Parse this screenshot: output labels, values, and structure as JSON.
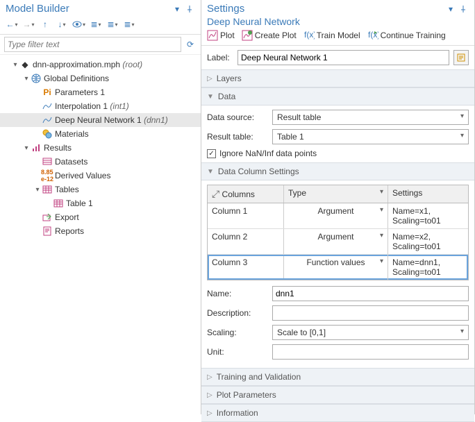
{
  "left_panel": {
    "title": "Model Builder",
    "filter_placeholder": "Type filter text",
    "tree": {
      "root": {
        "label": "dnn-approximation.mph",
        "suffix": "(root)"
      },
      "global_def": {
        "label": "Global Definitions"
      },
      "parameters": {
        "label": "Parameters 1"
      },
      "interpolation": {
        "label": "Interpolation 1",
        "suffix": "(int1)"
      },
      "dnn": {
        "label": "Deep Neural Network 1",
        "suffix": "(dnn1)"
      },
      "materials": {
        "label": "Materials"
      },
      "results": {
        "label": "Results"
      },
      "datasets": {
        "label": "Datasets"
      },
      "derived": {
        "label": "Derived Values"
      },
      "tables": {
        "label": "Tables"
      },
      "table1": {
        "label": "Table 1"
      },
      "export": {
        "label": "Export"
      },
      "reports": {
        "label": "Reports"
      }
    }
  },
  "right_panel": {
    "title": "Settings",
    "subtitle": "Deep Neural Network",
    "toolbar": {
      "plot": "Plot",
      "create_plot": "Create Plot",
      "train": "Train Model",
      "continue": "Continue Training"
    },
    "label_label": "Label:",
    "label_value": "Deep Neural Network 1",
    "sections": {
      "layers": "Layers",
      "data": "Data",
      "col_settings": "Data Column Settings",
      "train_val": "Training and Validation",
      "plot_params": "Plot Parameters",
      "info": "Information"
    },
    "data": {
      "source_label": "Data source:",
      "source_value": "Result table",
      "table_label": "Result table:",
      "table_value": "Table 1",
      "ignore_label": "Ignore NaN/Inf data points"
    },
    "grid": {
      "hdr_columns": "Columns",
      "hdr_type": "Type",
      "hdr_settings": "Settings",
      "rows": [
        {
          "col": "Column 1",
          "type": "Argument",
          "settings": "Name=x1, Scaling=to01"
        },
        {
          "col": "Column 2",
          "type": "Argument",
          "settings": "Name=x2, Scaling=to01"
        },
        {
          "col": "Column 3",
          "type": "Function values",
          "settings": "Name=dnn1, Scaling=to01"
        }
      ]
    },
    "fields": {
      "name_label": "Name:",
      "name_value": "dnn1",
      "desc_label": "Description:",
      "desc_value": "",
      "scaling_label": "Scaling:",
      "scaling_value": "Scale to [0,1]",
      "unit_label": "Unit:",
      "unit_value": ""
    }
  }
}
